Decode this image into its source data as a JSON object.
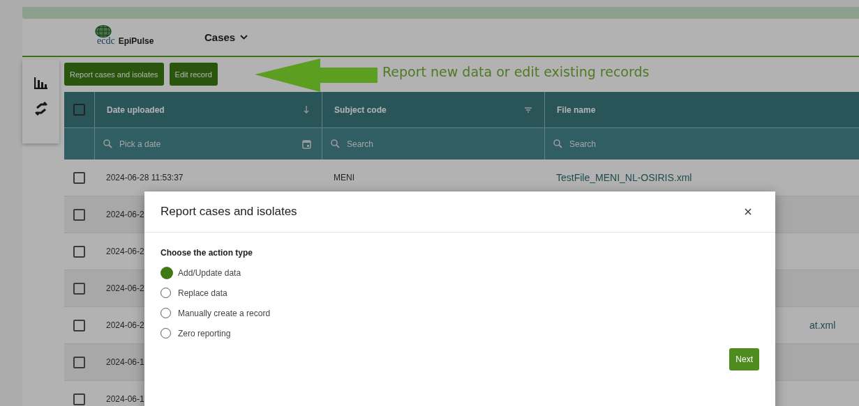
{
  "header": {
    "logo_mark": "ecdc",
    "logo_name": "EpiPulse",
    "menu": "Cases"
  },
  "toolbar": {
    "buttons": [
      "Report cases and isolates",
      "Edit record"
    ]
  },
  "annotation": "Report new data or edit existing records",
  "table": {
    "select_all_checked": false,
    "columns": [
      {
        "label": "Date uploaded",
        "filter_placeholder": "Pick a date"
      },
      {
        "label": "Subject code",
        "filter_placeholder": "Search"
      },
      {
        "label": "File name",
        "filter_placeholder": "Search"
      }
    ],
    "rows": [
      {
        "checked": false,
        "date": "2024-06-28 11:53:37",
        "subject": "MENI",
        "file": "TestFile_MENI_NL-OSIRIS.xml"
      },
      {
        "checked": false,
        "date": "2024-06-2"
      },
      {
        "checked": false,
        "date": "2024-06-2"
      },
      {
        "checked": false,
        "date": "2024-06-2"
      },
      {
        "checked": false,
        "date": "2024-06-2",
        "file": "at.xml"
      },
      {
        "checked": false,
        "date": "2024-06-1"
      },
      {
        "checked": false,
        "date": "2024-06-1"
      }
    ]
  },
  "dialog": {
    "title": "Report cases and isolates",
    "question": "Choose the action type",
    "options": [
      {
        "label": "Add/Update data",
        "selected": true
      },
      {
        "label": "Replace data",
        "selected": false
      },
      {
        "label": "Manually create a record",
        "selected": false
      },
      {
        "label": "Zero reporting",
        "selected": false
      }
    ],
    "next": "Next"
  }
}
